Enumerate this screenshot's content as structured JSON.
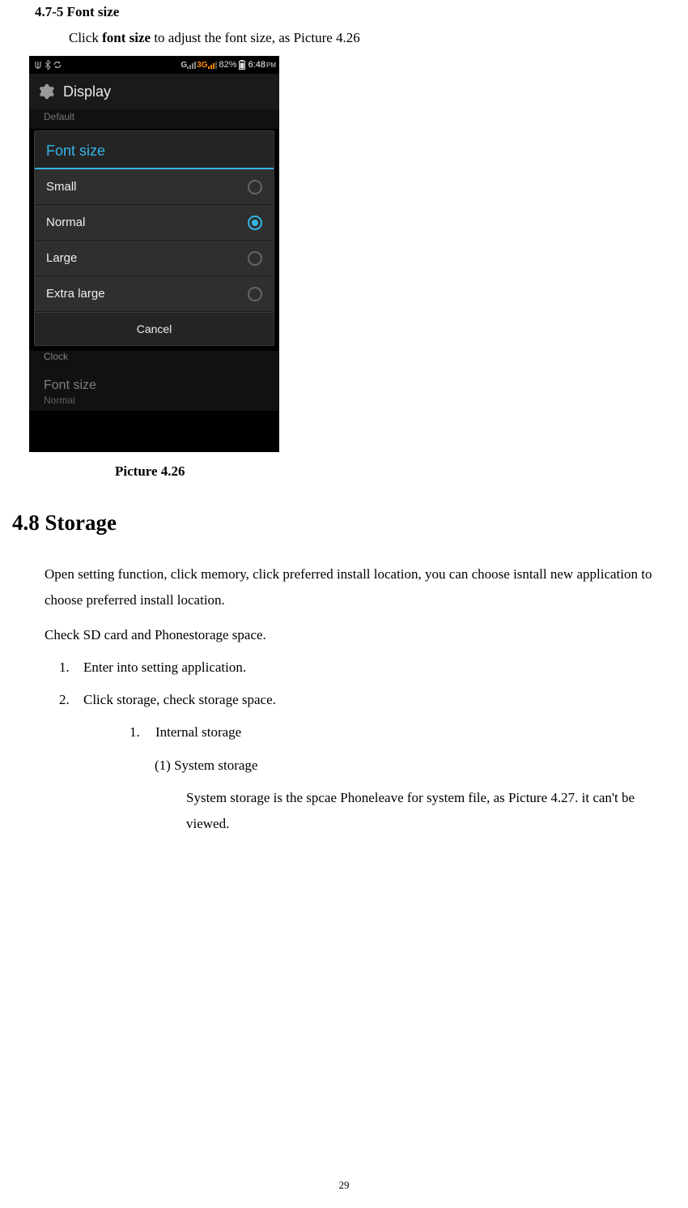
{
  "section_header": "4.7-5 Font size",
  "instruction_pre": "Click ",
  "instruction_bold": "font size",
  "instruction_post": " to adjust the font size, as Picture 4.26",
  "screenshot": {
    "statusbar": {
      "g": "G",
      "threeg": "3G",
      "battery_pct": "82%",
      "time": "6:48",
      "ampm": "PM"
    },
    "title": "Display",
    "underlay_sub": "Default",
    "dialog_title": "Font size",
    "options": [
      {
        "label": "Small",
        "selected": false
      },
      {
        "label": "Normal",
        "selected": true
      },
      {
        "label": "Large",
        "selected": false
      },
      {
        "label": "Extra large",
        "selected": false
      }
    ],
    "cancel": "Cancel",
    "clock_sub": "Clock",
    "fontsize_row_label": "Font size",
    "fontsize_row_sub": "Normal"
  },
  "caption": "Picture 4.26",
  "heading": "4.8 Storage",
  "para1": "Open setting function, click memory, click preferred install location, you can choose isntall new application to choose preferred install location.",
  "para2": "Check SD card and Phonestorage space.",
  "list": {
    "item1_num": "1.",
    "item1": "Enter into setting application.",
    "item2_num": "2.",
    "item2": "Click storage, check storage space.",
    "sub1_num": "1.",
    "sub1": "Internal storage",
    "subsub1": "(1) System storage",
    "subsub1_body": "System storage is the spcae Phoneleave for system file, as Picture 4.27. it can't be viewed."
  },
  "page_number": "29"
}
